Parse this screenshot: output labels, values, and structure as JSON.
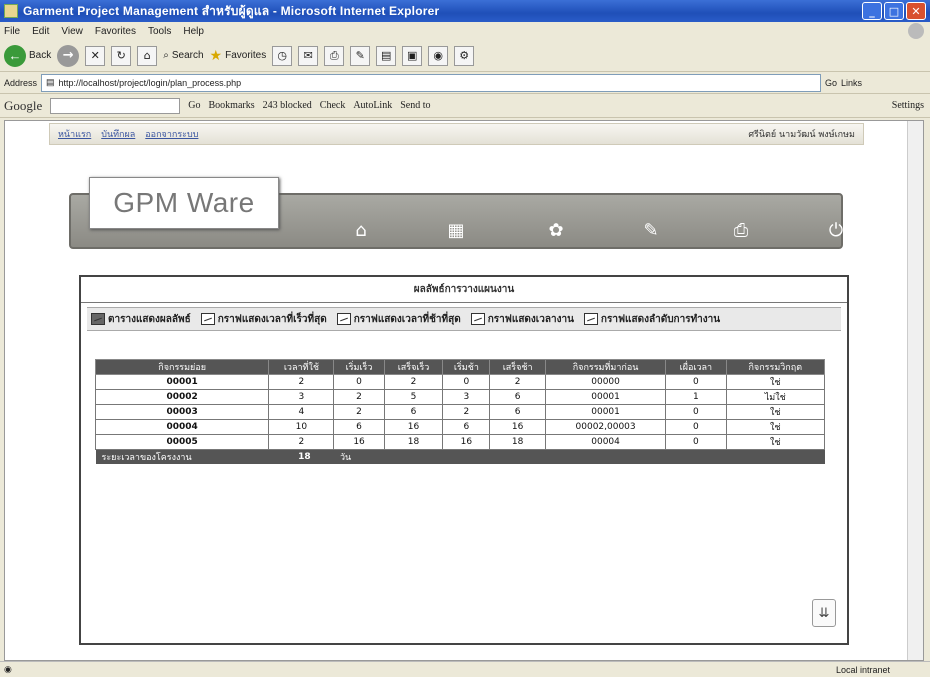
{
  "window": {
    "title": "Garment Project Management สำหรับผู้ดูแล - Microsoft Internet Explorer"
  },
  "menu": [
    "File",
    "Edit",
    "View",
    "Favorites",
    "Tools",
    "Help"
  ],
  "toolbar": {
    "back_label": "Back",
    "search_label": "Search",
    "favorites_label": "Favorites"
  },
  "address": {
    "label": "Address",
    "url": "http://localhost/project/login/plan_process.php",
    "go_label": "Go",
    "links_label": "Links"
  },
  "google_bar": {
    "logo": "Google",
    "go_label": "Go",
    "bookmarks_label": "Bookmarks",
    "blocked_label": "243 blocked",
    "check_label": "Check",
    "autolink_label": "AutoLink",
    "sendto_label": "Send to",
    "settings_label": "Settings"
  },
  "nav": {
    "links": [
      "หน้าแรก",
      "บันทึกผล",
      "ออกจากระบบ"
    ],
    "user": "ศรีนิตย์ นามวัฒน์ พงษ์เกษม"
  },
  "banner": {
    "logo_text": "GPM Ware",
    "icons": [
      "home-icon",
      "calendar-icon",
      "gear-icon",
      "pen-icon",
      "printer-icon",
      "power-icon"
    ]
  },
  "panel": {
    "title": "ผลลัพธ์การวางแผนงาน",
    "reports": [
      "ตารางแสดงผลลัพธ์",
      "กราฟแสดงเวลาที่เร็วที่สุด",
      "กราฟแสดงเวลาที่ช้าที่สุด",
      "กราฟแสดงเวลางาน",
      "กราฟแสดงลำดับการทำงาน"
    ]
  },
  "table": {
    "headers": [
      "กิจกรรมย่อย",
      "เวลาที่ใช้",
      "เริ่มเร็ว",
      "เสร็จเร็ว",
      "เริ่มช้า",
      "เสร็จช้า",
      "กิจกรรมที่มาก่อน",
      "เผื่อเวลา",
      "กิจกรรมวิกฤต"
    ],
    "rows": [
      [
        "00001",
        "2",
        "0",
        "2",
        "0",
        "2",
        "00000",
        "0",
        "ใช่"
      ],
      [
        "00002",
        "3",
        "2",
        "5",
        "3",
        "6",
        "00001",
        "1",
        "ไม่ใช่"
      ],
      [
        "00003",
        "4",
        "2",
        "6",
        "2",
        "6",
        "00001",
        "0",
        "ใช่"
      ],
      [
        "00004",
        "10",
        "6",
        "16",
        "6",
        "16",
        "00002,00003",
        "0",
        "ใช่"
      ],
      [
        "00005",
        "2",
        "16",
        "18",
        "16",
        "18",
        "00004",
        "0",
        "ใช่"
      ]
    ],
    "total_label": "ระยะเวลาของโครงงาน",
    "total_value": "18",
    "total_unit": "วัน"
  },
  "status": {
    "zone": "Local intranet"
  }
}
